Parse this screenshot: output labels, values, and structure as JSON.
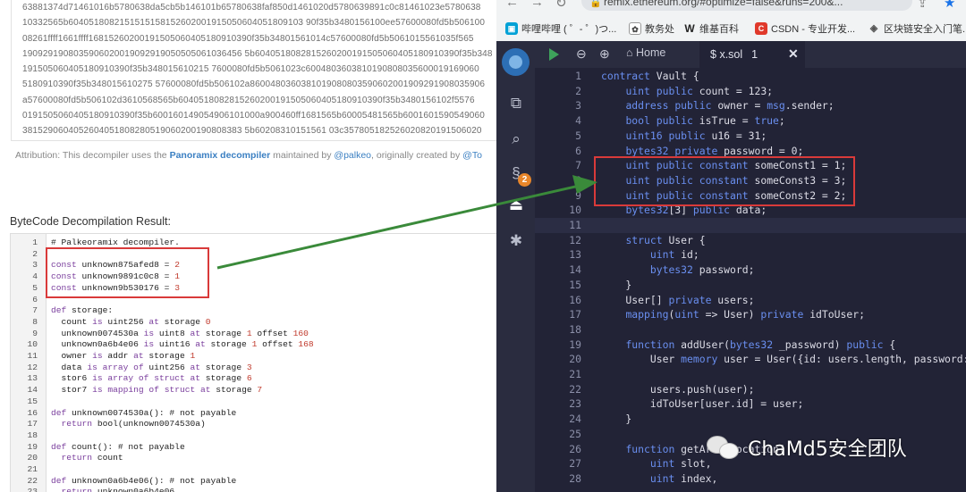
{
  "hex": {
    "lines": [
      "63881374d71461016b5780638da5cb5b146101b65780638faf850d1461020d5780639891c0c81461023e5780638",
      "10332565b6040518082151515158152602001915050604051809103 90f35b3480156100ee57600080fd5b506100",
      "08261ffff1661ffff16815260200191505060405180910390f35b34801561014c57600080fd5b5061015561035f565",
      "1909291908035906020019092919050505061036456 5b6040518082815260200191505060405180910390f35b348",
      "191505060405180910390f35b348015610215 7600080fd5b5061023c6004803603810190808035600019169060",
      "5180910390f35b348015610275 57600080fd5b506102a8600480360381019080803590602001909291908035906",
      "a57600080fd5b506102d3610568565b6040518082815260200191505060405180910390f35b3480156102f5576",
      "0191505060405180910390f35b600160149054906101000a900460ff1681565b60005481565b6001601590549060",
      "3815290604052604051808280519060200190808383 5b60208310151561 03c357805182526020820191506020",
      "04051809103902060019004905091505056 5b60016000905490610100 0a900473ffffffffffffffffffffffff168"
    ]
  },
  "attribution": {
    "prefix": "Attribution: This decompiler uses the ",
    "tool": "Panoramix decompiler",
    "mid": " maintained by ",
    "maintainer": "@palkeo",
    "suffix": ", originally created by ",
    "creator": "@To"
  },
  "result_title": "ByteCode Decompilation Result:",
  "decompiled_lines": [
    {
      "n": "1",
      "t": "# Palkeoramix decompiler."
    },
    {
      "n": "2",
      "t": ""
    },
    {
      "n": "3",
      "t": "const unknown875afed8 = 2"
    },
    {
      "n": "4",
      "t": "const unknown9891c0c8 = 1"
    },
    {
      "n": "5",
      "t": "const unknown9b530176 = 3"
    },
    {
      "n": "6",
      "t": ""
    },
    {
      "n": "7",
      "t": "def storage:"
    },
    {
      "n": "8",
      "t": "  count is uint256 at storage 0"
    },
    {
      "n": "9",
      "t": "  unknown0074530a is uint8 at storage 1 offset 160"
    },
    {
      "n": "10",
      "t": "  unknown0a6b4e06 is uint16 at storage 1 offset 168"
    },
    {
      "n": "11",
      "t": "  owner is addr at storage 1"
    },
    {
      "n": "12",
      "t": "  data is array of uint256 at storage 3"
    },
    {
      "n": "13",
      "t": "  stor6 is array of struct at storage 6"
    },
    {
      "n": "14",
      "t": "  stor7 is mapping of struct at storage 7"
    },
    {
      "n": "15",
      "t": ""
    },
    {
      "n": "16",
      "t": "def unknown0074530a(): # not payable"
    },
    {
      "n": "17",
      "t": "  return bool(unknown0074530a)"
    },
    {
      "n": "18",
      "t": ""
    },
    {
      "n": "19",
      "t": "def count(): # not payable"
    },
    {
      "n": "20",
      "t": "  return count"
    },
    {
      "n": "21",
      "t": ""
    },
    {
      "n": "22",
      "t": "def unknown0a6b4e06(): # not payable"
    },
    {
      "n": "23",
      "t": "  return unknown0a6b4e06"
    }
  ],
  "browser": {
    "url": "remix.ethereum.org/#optimize=false&runs=200&...",
    "bookmarks": [
      {
        "icon": "bilibili-icon",
        "label": "哔哩哔哩 ( ゜- ゜)つ..."
      },
      {
        "icon": "gear-icon",
        "label": "教务处"
      },
      {
        "icon": "wikipedia-icon",
        "label": "维基百科"
      },
      {
        "icon": "csdn-icon",
        "label": "CSDN - 专业开发..."
      },
      {
        "icon": "shield-icon",
        "label": "区块链安全入门笔..."
      }
    ]
  },
  "remix": {
    "home_tab": "Home",
    "file_tab": "x.sol",
    "file_badge": "1",
    "plugin_badge": "2",
    "lines": [
      {
        "n": "1",
        "t": "contract Vault {"
      },
      {
        "n": "2",
        "t": "    uint public count = 123;"
      },
      {
        "n": "3",
        "t": "    address public owner = msg.sender;"
      },
      {
        "n": "4",
        "t": "    bool public isTrue = true;"
      },
      {
        "n": "5",
        "t": "    uint16 public u16 = 31;"
      },
      {
        "n": "6",
        "t": "    bytes32 private password = 0;"
      },
      {
        "n": "7",
        "t": "    uint public constant someConst1 = 1;"
      },
      {
        "n": "8",
        "t": "    uint public constant someConst3 = 3;"
      },
      {
        "n": "9",
        "t": "    uint public constant someConst2 = 2;"
      },
      {
        "n": "10",
        "t": "    bytes32[3] public data;"
      },
      {
        "n": "11",
        "t": ""
      },
      {
        "n": "12",
        "t": "    struct User {"
      },
      {
        "n": "13",
        "t": "        uint id;"
      },
      {
        "n": "14",
        "t": "        bytes32 password;"
      },
      {
        "n": "15",
        "t": "    }"
      },
      {
        "n": "16",
        "t": "    User[] private users;"
      },
      {
        "n": "17",
        "t": "    mapping(uint => User) private idToUser;"
      },
      {
        "n": "18",
        "t": ""
      },
      {
        "n": "19",
        "t": "    function addUser(bytes32 _password) public {"
      },
      {
        "n": "20",
        "t": "        User memory user = User({id: users.length, password:"
      },
      {
        "n": "21",
        "t": ""
      },
      {
        "n": "22",
        "t": "        users.push(user);"
      },
      {
        "n": "23",
        "t": "        idToUser[user.id] = user;"
      },
      {
        "n": "24",
        "t": "    }"
      },
      {
        "n": "25",
        "t": ""
      },
      {
        "n": "26",
        "t": "    function getArrayLocation("
      },
      {
        "n": "27",
        "t": "        uint slot,"
      },
      {
        "n": "28",
        "t": "        uint index,"
      }
    ]
  },
  "watermark": "ChaMd5安全团队",
  "colors": {
    "accent_red": "#d93a3a",
    "arrow_green": "#3a8a3a",
    "remix_bg": "#222336"
  }
}
